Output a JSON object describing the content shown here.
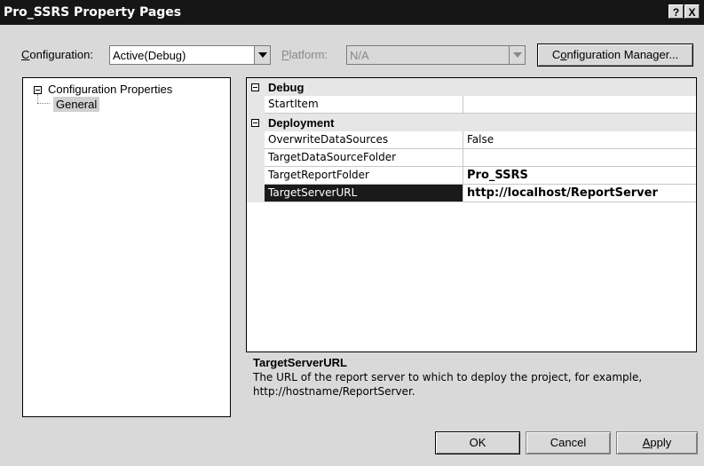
{
  "window": {
    "title": "Pro_SSRS Property Pages",
    "help_button": "?",
    "close_button": "X"
  },
  "config_bar": {
    "configuration_label_underlined": "C",
    "configuration_label_rest": "onfiguration:",
    "configuration_value": "Active(Debug)",
    "platform_label_underlined": "P",
    "platform_label_rest": "latform:",
    "platform_value": "N/A",
    "manager_button_pre": "C",
    "manager_button_underlined": "o",
    "manager_button_rest": "nfiguration Manager..."
  },
  "tree": {
    "root": "Configuration Properties",
    "child": "General"
  },
  "grid": {
    "categories": {
      "debug": "Debug",
      "deployment": "Deployment"
    },
    "rows": {
      "start_item": {
        "name": "StartItem",
        "value": ""
      },
      "overwrite": {
        "name": "OverwriteDataSources",
        "value": "False"
      },
      "ds_folder": {
        "name": "TargetDataSourceFolder",
        "value": ""
      },
      "report_folder": {
        "name": "TargetReportFolder",
        "value": "Pro_SSRS"
      },
      "server_url": {
        "name": "TargetServerURL",
        "value": "http://localhost/ReportServer"
      }
    }
  },
  "description": {
    "title": "TargetServerURL",
    "line1": "The URL of the report server to which to deploy the project, for example,",
    "line2": "http://hostname/ReportServer."
  },
  "buttons": {
    "ok": "OK",
    "cancel": "Cancel",
    "apply_underlined": "A",
    "apply_rest": "pply"
  }
}
